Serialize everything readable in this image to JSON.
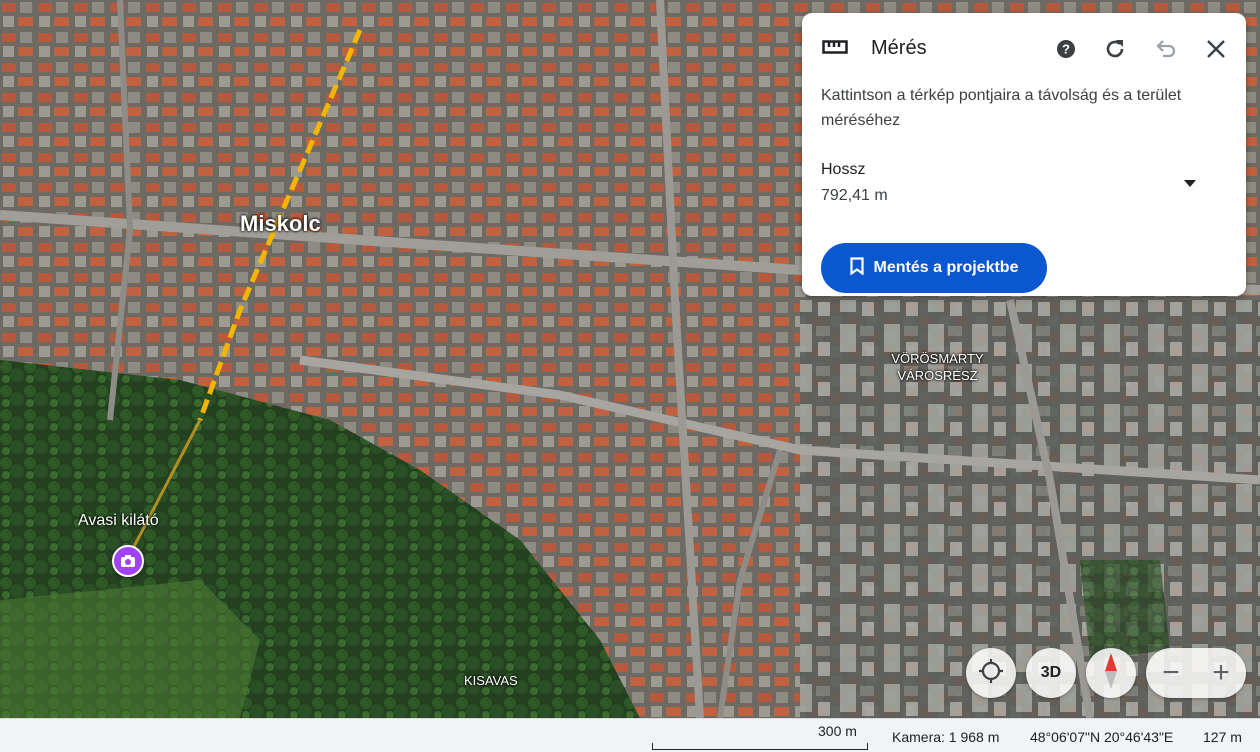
{
  "map": {
    "city_label": "Miskolc",
    "poi_label": "Avasi kilátó",
    "district_label_line1": "VÖRÖSMARTY",
    "district_label_line2": "VÁROSRÉSZ",
    "area_label": "KISAVAS",
    "measure_line_color": "#f5b400"
  },
  "panel": {
    "title": "Mérés",
    "description": "Kattintson a térkép pontjaira a távolság és a terület méréséhez",
    "length_label": "Hossz",
    "length_value": "792,41 m",
    "save_button": "Mentés a projektbe",
    "icons": [
      "ruler-icon",
      "help-icon",
      "refresh-icon",
      "undo-icon",
      "close-icon",
      "dropdown-icon",
      "bookmark-icon"
    ]
  },
  "controls": {
    "btn_3d": "3D",
    "zoom_out": "−",
    "zoom_in": "+"
  },
  "statusbar": {
    "scale": "300 m",
    "camera": "Kamera: 1 968 m",
    "coords": "48°06'07\"N 20°46'43\"E",
    "elevation": "127 m"
  },
  "colors": {
    "accent": "#0b57d0",
    "poi": "#a142f4"
  }
}
